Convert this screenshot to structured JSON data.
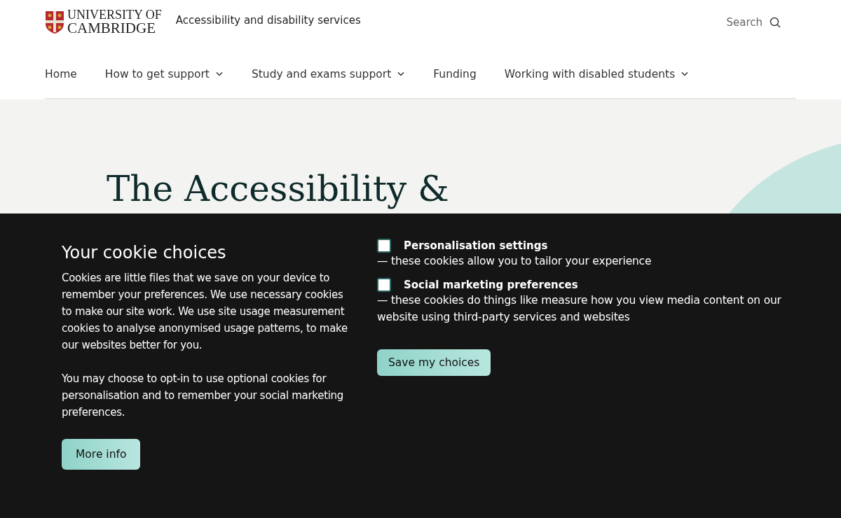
{
  "header": {
    "logo_lines": [
      "UNIVERSITY OF",
      "CAMBRIDGE"
    ],
    "site_title": "Accessibility and disability services",
    "search": "Search"
  },
  "nav": [
    {
      "label": "Home",
      "dropdown": false
    },
    {
      "label": "How to get support",
      "dropdown": true
    },
    {
      "label": "Study and exams support",
      "dropdown": true
    },
    {
      "label": "Funding",
      "dropdown": false
    },
    {
      "label": "Working with disabled students",
      "dropdown": true
    }
  ],
  "hero": {
    "title": "The Accessibility &"
  },
  "cookie_banner": {
    "heading": "Your cookie choices",
    "paragraphs": [
      "Cookies are little files that we save on your device to remember your preferences. We use necessary cookies to make our site work. We use site usage measurement cookies to analyse anonymised usage patterns, to make our websites better for you.",
      "You may choose to opt-in to use optional cookies for personalisation and to remember your social marketing preferences."
    ],
    "more_info": "More info",
    "options": [
      {
        "label": "Personalisation settings",
        "description": "— these cookies allow you to tailor your experience",
        "checked": false
      },
      {
        "label": "Social marketing preferences",
        "description": "— these cookies do things like measure how you view media content on our website using third-party services and websites",
        "checked": false
      }
    ],
    "save": "Save my choices"
  }
}
